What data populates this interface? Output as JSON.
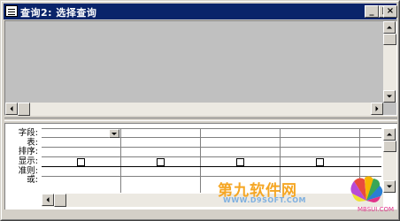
{
  "window": {
    "title": "查询2: 选择查询",
    "minimize_glyph": "_",
    "maximize_glyph": "□",
    "close_glyph": "×"
  },
  "design_grid": {
    "row_labels": [
      "字段:",
      "表:",
      "排序:",
      "显示:",
      "准则:",
      "或:"
    ],
    "column_count": 5,
    "show_checked": [
      false,
      false,
      false,
      false
    ]
  },
  "watermark": {
    "title": "第九软件网",
    "url": "WWW.D9SOFT.COM",
    "site": "MBSUI.COM",
    "colors": {
      "title": "#f5a623",
      "url": "#7fb0e0",
      "site": "#e0338a"
    }
  },
  "colors": {
    "titlebar": "#0a246a",
    "window_face": "#d4d0c8",
    "table_pane": "#c0c0c0",
    "grid_background": "#ffffff"
  },
  "icons": [
    "query-window-icon",
    "minimize-icon",
    "maximize-icon",
    "close-icon",
    "scroll-up-icon",
    "scroll-down-icon",
    "scroll-left-icon",
    "scroll-right-icon",
    "dropdown-arrow-icon"
  ]
}
